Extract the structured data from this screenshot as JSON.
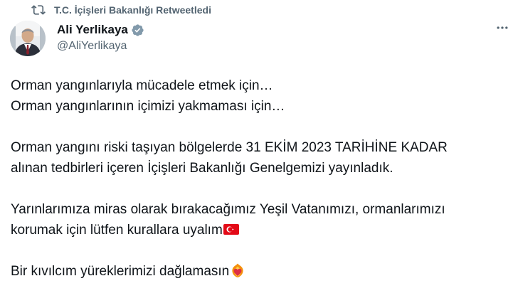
{
  "retweet": {
    "label": "T.C. İçişleri Bakanlığı Retweetledi",
    "icon": "retweet-icon"
  },
  "author": {
    "name": "Ali Yerlikaya",
    "handle": "@AliYerlikaya",
    "verified_icon": "verified-badge-icon",
    "avatar_icon": "avatar-photo"
  },
  "more_icon": "more-horizontal-icon",
  "tweet": {
    "lines": [
      "Orman yangınlarıyla mücadele etmek için…",
      "Orman yangınlarının içimizi yakmaması için…",
      "Orman yangını riski taşıyan bölgelerde 31 EKİM 2023 TARİHİNE KADAR",
      "alınan tedbirleri içeren İçişleri Bakanlığı Genelgemizi yayınladık.",
      "Yarınlarımıza miras olarak bırakacağımız Yeşil Vatanımızı, ormanlarımızı",
      "korumak için lütfen kurallara uyalım",
      "Bir kıvılcım yüreklerimizi dağlamasın"
    ],
    "emoji_flag": "turkey-flag-icon",
    "emoji_heart": "heart-on-fire-icon"
  },
  "colors": {
    "text": "#0f1419",
    "secondary": "#536471",
    "verified": "#829aab",
    "flag_red": "#e30a17"
  }
}
